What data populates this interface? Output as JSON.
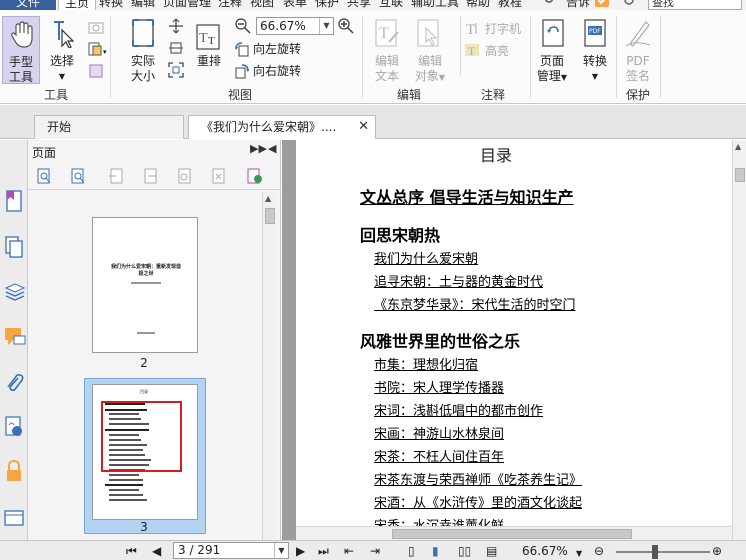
{
  "menubar": {
    "file": "文件",
    "active": "主页",
    "items": [
      "转换",
      "编辑",
      "页面管理",
      "注释",
      "视图",
      "表单",
      "保护",
      "共享",
      "互联",
      "辅助工具",
      "帮助",
      "教程"
    ],
    "right_item": "告诉",
    "search_placeholder": "查找"
  },
  "ribbon": {
    "tools_group": "工具",
    "hand": "手型\n工具",
    "hand_l1": "手型",
    "hand_l2": "工具",
    "select_l1": "选择",
    "view_group": "视图",
    "actual_l1": "实际",
    "actual_l2": "大小",
    "reflow": "重排",
    "zoom_value": "66.67%",
    "rotate_left": "向左旋转",
    "rotate_right": "向右旋转",
    "edit_group": "编辑",
    "edit_text_l1": "编辑",
    "edit_text_l2": "文本",
    "edit_obj_l1": "编辑",
    "edit_obj_l2": "对象",
    "typewriter": "打字机",
    "highlight": "高亮",
    "comment_group": "注释",
    "page_mgmt_l1": "页面",
    "page_mgmt_l2": "管理",
    "convert": "转换",
    "pdf_sign_l1": "PDF",
    "pdf_sign_l2": "签名",
    "protect_group": "保护"
  },
  "tabs": [
    {
      "label": "开始"
    },
    {
      "label": "《我们为什么爱宋朝》...."
    }
  ],
  "panel": {
    "title": "页面",
    "thumbs": [
      {
        "label": "2",
        "title_line1": "我们为什么爱宋朝：重新发现造",
        "title_line2": "极之世"
      },
      {
        "label": "3",
        "header": "目录"
      }
    ]
  },
  "document": {
    "toc_title": "目录",
    "entries": [
      {
        "type": "h",
        "text": "文丛总序 倡导生活与知识生产",
        "underline": true
      },
      {
        "type": "h",
        "text": "回思宋朝热",
        "underline": false
      },
      {
        "type": "i",
        "text": "我们为什么爱宋朝"
      },
      {
        "type": "i",
        "text": "追寻宋朝：土与器的黄金时代"
      },
      {
        "type": "i",
        "text": "《东京梦华录》：宋代生活的时空门"
      },
      {
        "type": "h",
        "text": "风雅世界里的世俗之乐",
        "underline": false
      },
      {
        "type": "i",
        "text": "市集：理想化归宿"
      },
      {
        "type": "i",
        "text": "书院：宋人理学传播器"
      },
      {
        "type": "i",
        "text": "宋词：浅斟低唱中的都市创作"
      },
      {
        "type": "i",
        "text": "宋画：神游山水林泉间"
      },
      {
        "type": "i",
        "text": "宋茶：不枉人间住百年"
      },
      {
        "type": "i",
        "text": "宋茶东渡与荣西禅师《吃茶养生记》"
      },
      {
        "type": "i",
        "text": "宋酒：从《水浒传》里的酒文化谈起"
      },
      {
        "type": "i",
        "text": "宋香：水沉幸谁薰化鲜"
      }
    ]
  },
  "statusbar": {
    "page_value": "3 / 291",
    "zoom": "66.67%"
  },
  "colors": {
    "file_menu": "#3a5f9d",
    "hand_selected": "#d8d2ee",
    "thumb_selected": "#b3d3f3",
    "red_box": "#d21f1f"
  }
}
